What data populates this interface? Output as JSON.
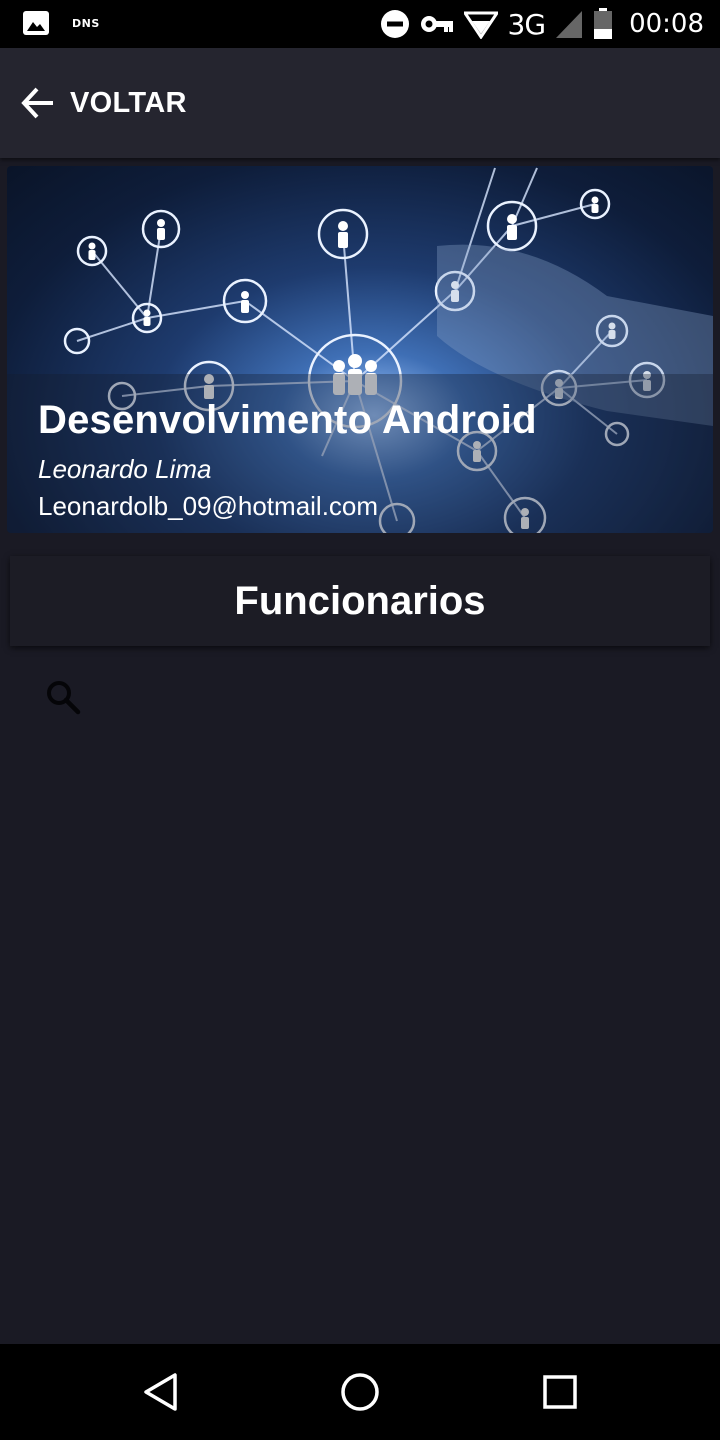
{
  "status_bar": {
    "left_icons": [
      "image-notification-icon"
    ],
    "dns_label": "DNS",
    "network_type": "3G",
    "time": "00:08",
    "right_icons": [
      "do-not-disturb-icon",
      "vpn-key-icon",
      "wifi-icon",
      "signal-icon",
      "battery-icon"
    ]
  },
  "app_bar": {
    "back_label": "VOLTAR",
    "back_icon": "arrow-left-icon"
  },
  "banner": {
    "title": "Desenvolvimento Android",
    "author": "Leonardo Lima",
    "email": "Leonardolb_09@hotmail.com"
  },
  "section": {
    "title": "Funcionarios"
  },
  "search": {
    "icon": "search-icon",
    "placeholder": "",
    "value": ""
  },
  "nav_bar": {
    "buttons": [
      "back-triangle-icon",
      "home-circle-icon",
      "recents-square-icon"
    ]
  },
  "colors": {
    "background": "#1a1a24",
    "app_bar": "#25252f",
    "card": "#1c1c25",
    "text": "#ffffff"
  }
}
